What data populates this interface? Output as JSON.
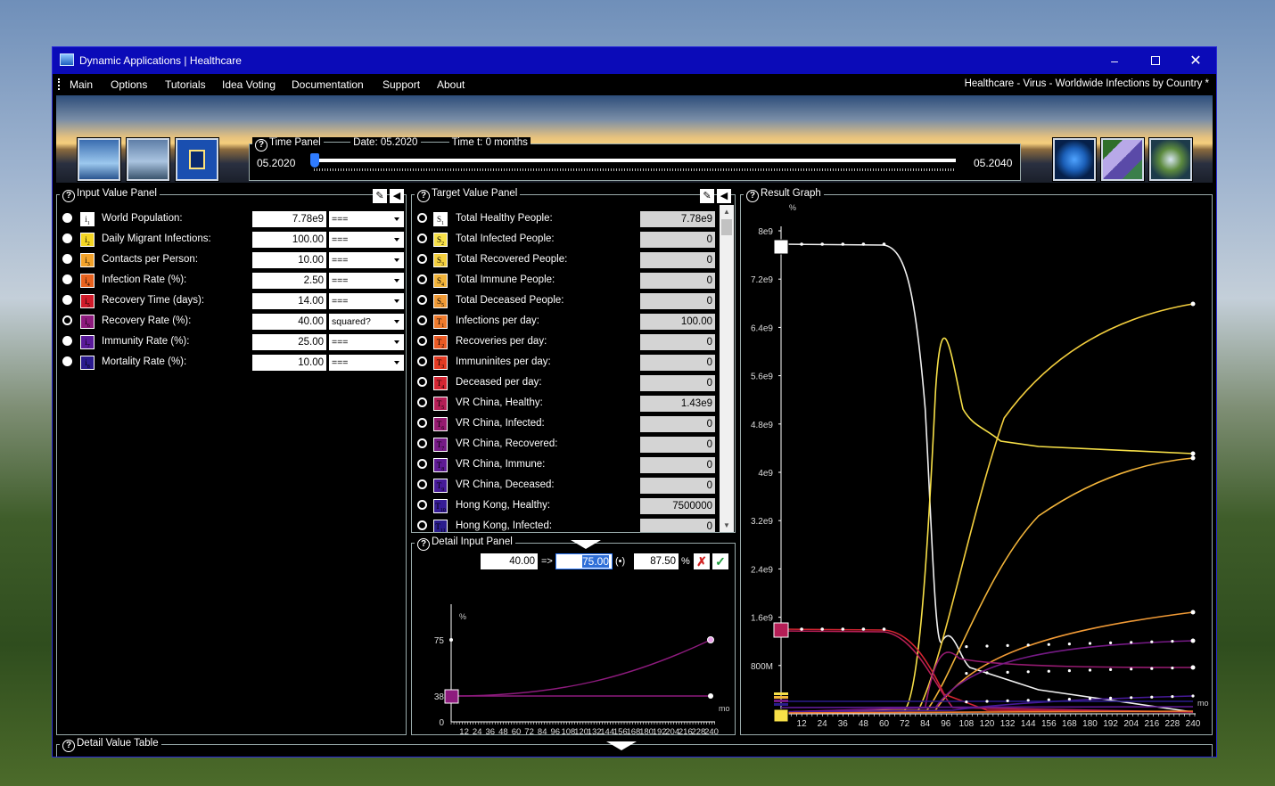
{
  "window": {
    "title": "Dynamic Applications | Healthcare",
    "doc_title": "Healthcare - Virus - Worldwide Infections by Country *"
  },
  "menu": [
    "Main",
    "Options",
    "Tutorials",
    "Idea Voting",
    "Documentation",
    "Support",
    "About"
  ],
  "time_panel": {
    "title": "Time Panel",
    "date_label": "Date:",
    "date": "05.2020",
    "time_label": "Time t:",
    "time": "0 months",
    "start": "05.2020",
    "end": "05.2040"
  },
  "input_panel": {
    "title": "Input Value Panel",
    "rows": [
      {
        "sym": "i",
        "sub": "1",
        "label": "World Population:",
        "value": "7.78e9",
        "mode": "===",
        "color": "#ffffff",
        "selected": false
      },
      {
        "sym": "i",
        "sub": "2",
        "label": "Daily Migrant Infections:",
        "value": "100.00",
        "mode": "===",
        "color": "#f5d623",
        "selected": false
      },
      {
        "sym": "i",
        "sub": "3",
        "label": "Contacts per Person:",
        "value": "10.00",
        "mode": "===",
        "color": "#f2a22a",
        "selected": false
      },
      {
        "sym": "i",
        "sub": "4",
        "label": "Infection Rate (%):",
        "value": "2.50",
        "mode": "===",
        "color": "#e8621e",
        "selected": false
      },
      {
        "sym": "i",
        "sub": "5",
        "label": "Recovery Time (days):",
        "value": "14.00",
        "mode": "===",
        "color": "#d01b2a",
        "selected": false
      },
      {
        "sym": "i",
        "sub": "6",
        "label": "Recovery Rate (%):",
        "value": "40.00",
        "mode": "squared?",
        "color": "#8e1b7e",
        "selected": true
      },
      {
        "sym": "i",
        "sub": "7",
        "label": "Immunity Rate (%):",
        "value": "25.00",
        "mode": "===",
        "color": "#5a1a9a",
        "selected": false
      },
      {
        "sym": "i",
        "sub": "8",
        "label": "Mortality Rate (%):",
        "value": "10.00",
        "mode": "===",
        "color": "#2a1a8e",
        "selected": false
      }
    ]
  },
  "target_panel": {
    "title": "Target Value Panel",
    "rows": [
      {
        "sym": "S",
        "sub": "1",
        "label": "Total Healthy People:",
        "value": "7.78e9",
        "color": "#ffffff"
      },
      {
        "sym": "S",
        "sub": "2",
        "label": "Total Infected People:",
        "value": "0",
        "color": "#f7e048"
      },
      {
        "sym": "S",
        "sub": "3",
        "label": "Total Recovered People:",
        "value": "0",
        "color": "#f4cf3e"
      },
      {
        "sym": "S",
        "sub": "4",
        "label": "Total Immune People:",
        "value": "0",
        "color": "#f2b43a"
      },
      {
        "sym": "S",
        "sub": "5",
        "label": "Total Deceased People:",
        "value": "0",
        "color": "#f09a36"
      },
      {
        "sym": "T",
        "sub": "1",
        "label": "Infections per day:",
        "value": "100.00",
        "color": "#ee7a2c"
      },
      {
        "sym": "T",
        "sub": "2",
        "label": "Recoveries per day:",
        "value": "0",
        "color": "#ea5a24"
      },
      {
        "sym": "T",
        "sub": "3",
        "label": "Immuninites per day:",
        "value": "0",
        "color": "#e33a22"
      },
      {
        "sym": "T",
        "sub": "4",
        "label": "Deceased per day:",
        "value": "0",
        "color": "#d42532"
      },
      {
        "sym": "T",
        "sub": "5",
        "label": "VR China, Healthy:",
        "value": "1.43e9",
        "color": "#b51e56"
      },
      {
        "sym": "T",
        "sub": "6",
        "label": "VR China, Infected:",
        "value": "0",
        "color": "#951a70"
      },
      {
        "sym": "T",
        "sub": "7",
        "label": "VR China, Recovered:",
        "value": "0",
        "color": "#761a86"
      },
      {
        "sym": "T",
        "sub": "8",
        "label": "VR China, Immune:",
        "value": "0",
        "color": "#5e1a94"
      },
      {
        "sym": "T",
        "sub": "9",
        "label": "VR China, Deceased:",
        "value": "0",
        "color": "#461a98"
      },
      {
        "sym": "T",
        "sub": "10",
        "label": "Hong Kong, Healthy:",
        "value": "7500000",
        "color": "#361c96"
      },
      {
        "sym": "T",
        "sub": "11",
        "label": "Hong Kong, Infected:",
        "value": "0",
        "color": "#2a1c8c"
      }
    ]
  },
  "detail_input": {
    "title": "Detail Input Panel",
    "from": "40.00",
    "arrow": "=>",
    "to": "75.00",
    "paren": "(•)",
    "pct": "87.50",
    "pct_sign": "%",
    "ylabel": "%",
    "xunit": "mo",
    "y_ticks": [
      "75",
      "38",
      "0"
    ],
    "x_ticks": [
      "12",
      "24",
      "36",
      "48",
      "60",
      "72",
      "84",
      "96",
      "108",
      "120",
      "132",
      "144",
      "156",
      "168",
      "180",
      "192",
      "204",
      "216",
      "228",
      "240"
    ]
  },
  "result_graph": {
    "title": "Result Graph",
    "ylabel": "%",
    "xunit": "mo",
    "y_ticks": [
      "8e9",
      "7.2e9",
      "6.4e9",
      "5.6e9",
      "4.8e9",
      "4e9",
      "3.2e9",
      "2.4e9",
      "1.6e9",
      "800M"
    ],
    "x_ticks": [
      "12",
      "24",
      "36",
      "48",
      "60",
      "72",
      "84",
      "96",
      "108",
      "120",
      "132",
      "144",
      "156",
      "168",
      "180",
      "192",
      "204",
      "216",
      "228",
      "240"
    ]
  },
  "detail_table": {
    "title": "Detail Value Table"
  },
  "colors": {
    "window_bg": "#000000",
    "titlebar": "#0b0bb8",
    "accent": "#4f8cff"
  },
  "icons": [
    "app-icon",
    "minimize-icon",
    "maximize-icon",
    "close-icon",
    "help-icon",
    "edit-icon",
    "collapse-icon",
    "cancel-icon",
    "confirm-icon"
  ]
}
